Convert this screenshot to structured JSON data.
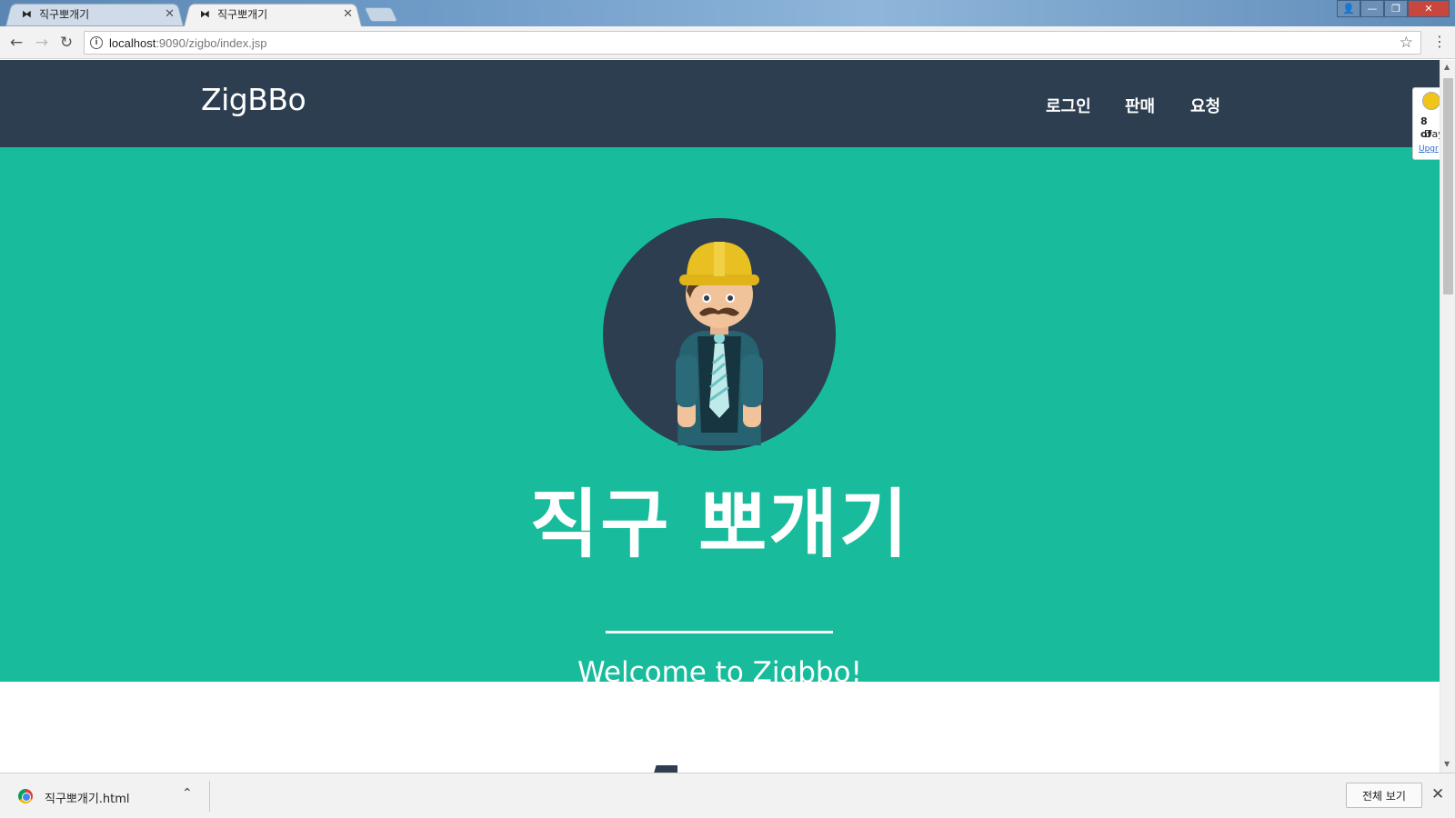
{
  "tabs": [
    {
      "title": "직구뽀개기",
      "favicon": "bowtie-icon",
      "close": "✕"
    },
    {
      "title": "직구뽀개기",
      "favicon": "bowtie-icon",
      "close": "✕"
    }
  ],
  "window_controls": {
    "user": "👤",
    "minimize": "—",
    "restore": "❐",
    "close": "✕"
  },
  "address_bar": {
    "host": "localhost",
    "rest": ":9090/zigbo/index.jsp"
  },
  "page": {
    "brand": "ZigBBo",
    "nav": {
      "login": "로그인",
      "sell": "판매",
      "request": "요청"
    },
    "hero": {
      "title": "직구 뽀개기",
      "subtitle": "Welcome to Zigbbo!"
    },
    "colors": {
      "navbar": "#2c3e50",
      "hero": "#18bc9c"
    }
  },
  "extension_widget": {
    "line1": "8 of",
    "line2": "Day",
    "link": "Upgr"
  },
  "download_shelf": {
    "filename": "직구뽀개기.html",
    "show_all": "전체 보기"
  }
}
